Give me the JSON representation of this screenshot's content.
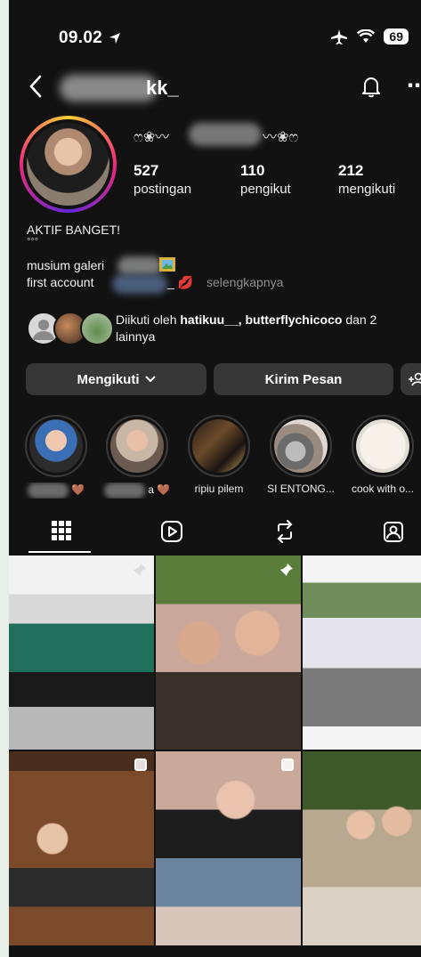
{
  "status_bar": {
    "time": "09.02",
    "battery": "69"
  },
  "header": {
    "username_visible": "kk_"
  },
  "profile": {
    "display_name_prefix": "ෆ❀〰",
    "display_name_suffix": "〰❀ෆ",
    "stats": [
      {
        "count": "527",
        "label": "postingan"
      },
      {
        "count": "110",
        "label": "pengikut"
      },
      {
        "count": "212",
        "label": "mengikuti"
      }
    ],
    "bio_line1": "AKTIF BANGET!",
    "bio_line2": "°°°",
    "bio_line3": "musium galeri",
    "bio_line4": "first account",
    "bio_line4_suffix": "_ 💋",
    "more_label": "selengkapnya"
  },
  "followed_by": {
    "prefix": "Diikuti oleh",
    "names": "hatikuu__, butterflychicoco",
    "suffix": "dan 2 lainnya"
  },
  "buttons": {
    "following": "Mengikuti",
    "message": "Kirim Pesan"
  },
  "highlights": [
    {
      "label": "🤎",
      "blurred": true
    },
    {
      "label": "a 🤎",
      "blurred": true
    },
    {
      "label": "ripiu pilem",
      "blurred": false
    },
    {
      "label": "SI ENTONG...",
      "blurred": false
    },
    {
      "label": "cook with o...",
      "blurred": false
    }
  ],
  "tabs": [
    "posts-grid",
    "reels",
    "reposts",
    "tagged"
  ],
  "colors": {
    "background": "#121212",
    "button": "#363636",
    "muted": "#8e8e8e"
  }
}
